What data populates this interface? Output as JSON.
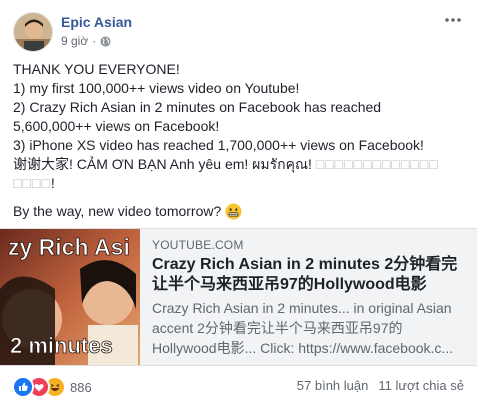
{
  "post": {
    "author": "Epic Asian",
    "time": "9 giờ",
    "separator": "·",
    "lines": [
      "THANK YOU EVERYONE!",
      "1) my first 100,000++ views video on Youtube!",
      "2) Crazy Rich Asian in 2 minutes on Facebook has reached",
      "5,600,000++ views on Facebook!",
      "3) iPhone XS video has reached 1,700,000++ views on Facebook!"
    ],
    "thanks_line": "谢谢大家! CẢM ƠN BẠN Anh yêu em! ผมรักคุณ! ",
    "unrendered_glyphs_1": "□□□□□□□□□□□□□",
    "unrendered_glyphs_2": "□□□□",
    "thanks_end": "!",
    "closing": "By the way, new video tomorrow? "
  },
  "preview": {
    "thumb_text_top": "zy Rich Asi",
    "thumb_text_bottom": "2 minutes",
    "domain": "YOUTUBE.COM",
    "title": "Crazy Rich Asian in 2 minutes 2分钟看完让半个马来西亚吊97的Hollywood电影",
    "description": "Crazy Rich Asian in 2 minutes... in original Asian accent 2分钟看完让半个马来西亚吊97的Hollywood电影... Click: https://www.facebook.c..."
  },
  "footer": {
    "reaction_count": "886",
    "comments": "57 bình luận",
    "shares": "11 lượt chia sẻ"
  },
  "colors": {
    "author": "#385898",
    "like": "#1877f2",
    "love": "#f33e58",
    "haha": "#f7b125"
  },
  "icons": [
    "globe-icon",
    "more-icon",
    "grimace-emoji-icon",
    "like-reaction-icon",
    "love-reaction-icon",
    "haha-reaction-icon"
  ]
}
